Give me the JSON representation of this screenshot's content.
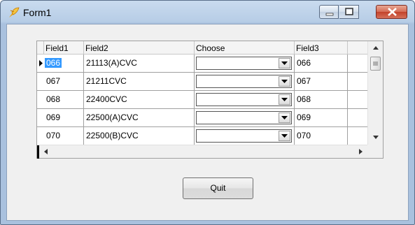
{
  "window": {
    "title": "Form1",
    "app_icon": "pencil-feather-icon"
  },
  "controls": {
    "minimize_icon": "minimize-icon",
    "maximize_icon": "maximize-icon",
    "close_icon": "close-icon"
  },
  "grid": {
    "columns": [
      "Field1",
      "Field2",
      "Choose",
      "Field3"
    ],
    "rows": [
      {
        "field1": "066",
        "field2": "21113(A)CVC",
        "choose": "",
        "field3": "066",
        "current": true
      },
      {
        "field1": "067",
        "field2": "21211CVC",
        "choose": "",
        "field3": "067"
      },
      {
        "field1": "068",
        "field2": "22400CVC",
        "choose": "",
        "field3": "068"
      },
      {
        "field1": "069",
        "field2": "22500(A)CVC",
        "choose": "",
        "field3": "069"
      },
      {
        "field1": "070",
        "field2": "22500(B)CVC",
        "choose": "",
        "field3": "070"
      }
    ]
  },
  "buttons": {
    "quit": "Quit"
  },
  "colors": {
    "selection": "#3399ff",
    "titlebar": "#b7cde6",
    "close": "#c2412a"
  }
}
